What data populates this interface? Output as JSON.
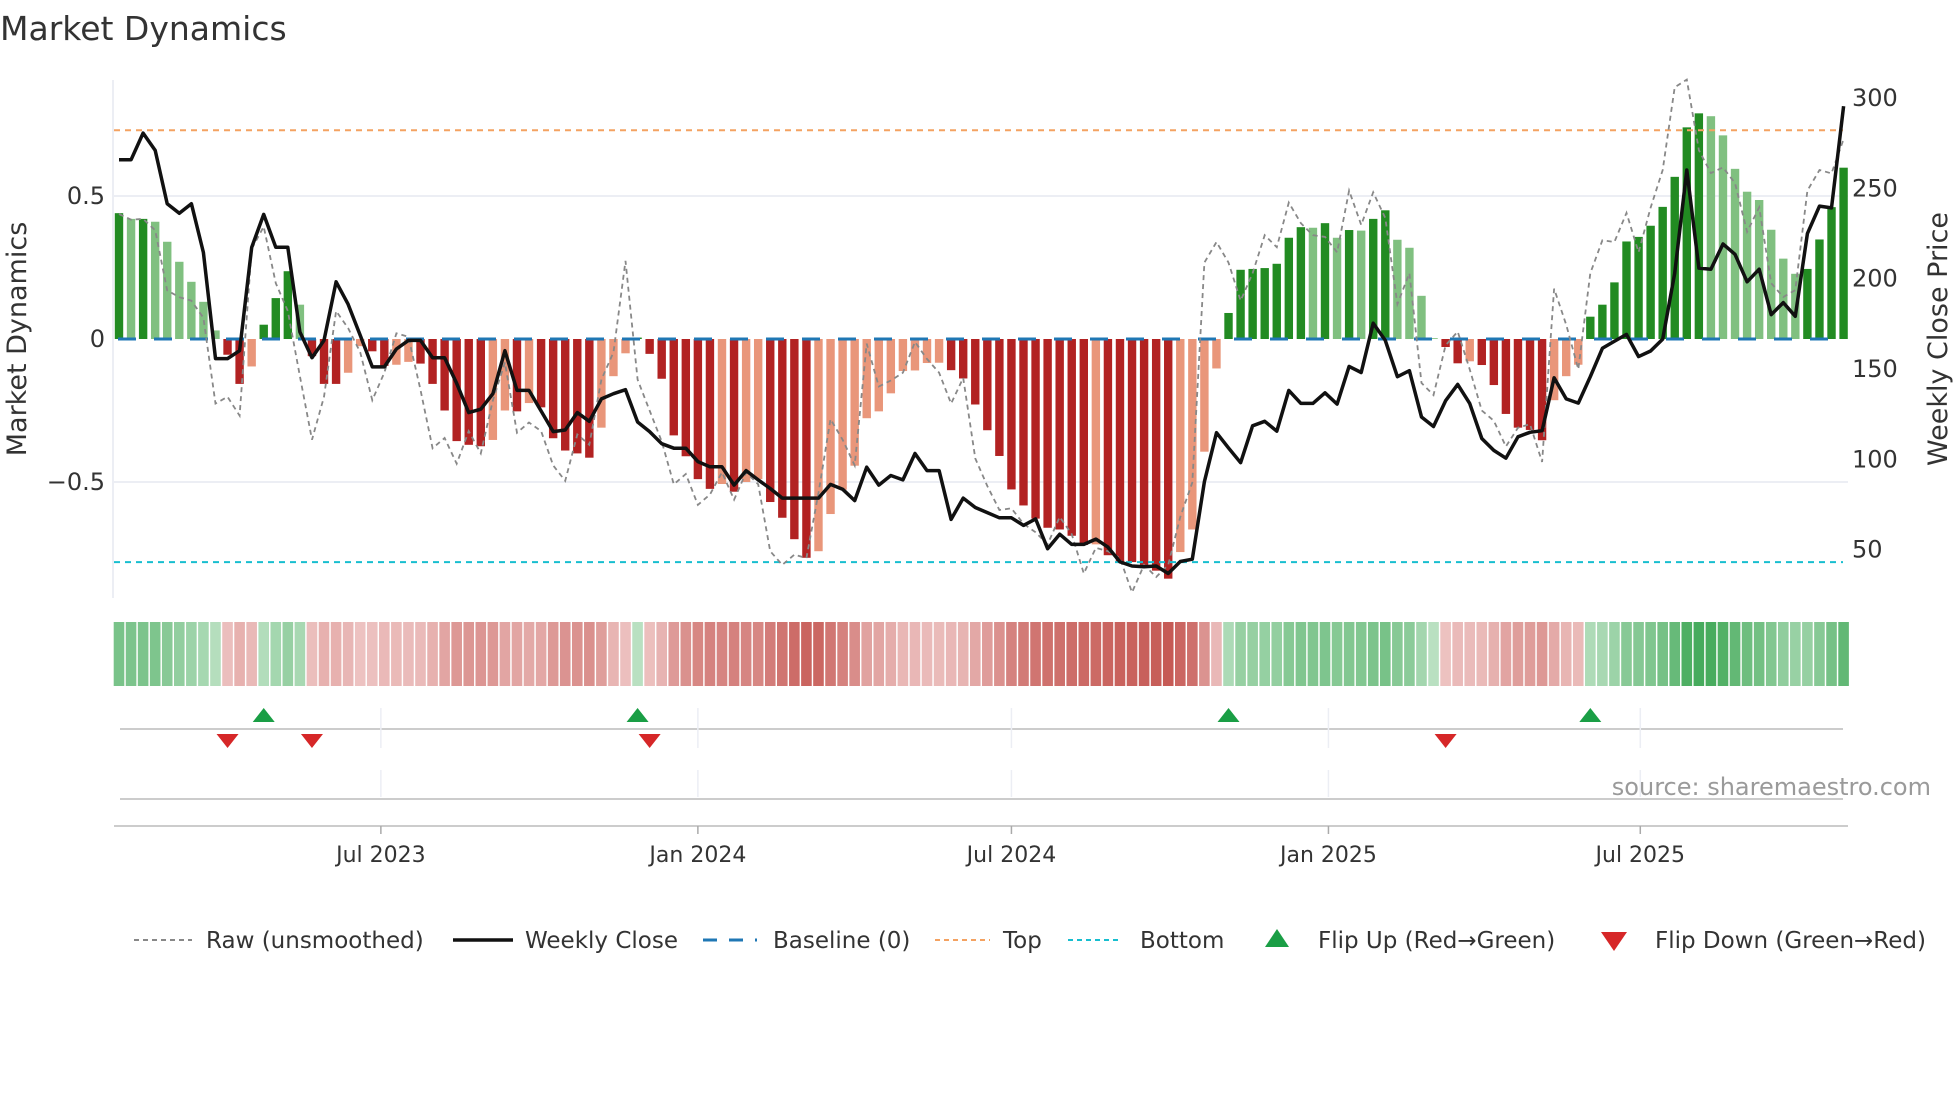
{
  "chart_data": {
    "type": "bar",
    "title": "Market Dynamics",
    "ylabel": "Market Dynamics",
    "y2label": "Weekly Close Price",
    "ylim": [
      -0.9,
      0.9
    ],
    "y2lim": [
      23.6,
      308.5
    ],
    "yticks": [
      {
        "value": 0.5,
        "label": "0.5"
      },
      {
        "value": 0,
        "label": "0"
      },
      {
        "value": -0.5,
        "label": "−0.5"
      }
    ],
    "y2ticks": [
      {
        "value": 300,
        "label": "300"
      },
      {
        "value": 250,
        "label": "250"
      },
      {
        "value": 200,
        "label": "200"
      },
      {
        "value": 150,
        "label": "150"
      },
      {
        "value": 100,
        "label": "100"
      },
      {
        "value": 50,
        "label": "50"
      }
    ],
    "xticks": [
      {
        "date": "2023-07-01",
        "label": "Jul 2023"
      },
      {
        "date": "2024-01-01",
        "label": "Jan 2024"
      },
      {
        "date": "2024-07-01",
        "label": "Jul 2024"
      },
      {
        "date": "2025-01-01",
        "label": "Jan 2025"
      },
      {
        "date": "2025-07-01",
        "label": "Jul 2025"
      }
    ],
    "grid": true,
    "legend_placement": "bottom",
    "top_threshold": 0.73,
    "bottom_threshold": -0.78,
    "baseline": 0,
    "dates": [
      "2023-01-30",
      "2023-02-06",
      "2023-02-13",
      "2023-02-20",
      "2023-02-27",
      "2023-03-06",
      "2023-03-13",
      "2023-03-20",
      "2023-03-27",
      "2023-04-03",
      "2023-04-10",
      "2023-04-17",
      "2023-04-24",
      "2023-05-01",
      "2023-05-08",
      "2023-05-15",
      "2023-05-22",
      "2023-05-29",
      "2023-06-05",
      "2023-06-12",
      "2023-06-19",
      "2023-06-26",
      "2023-07-03",
      "2023-07-10",
      "2023-07-17",
      "2023-07-24",
      "2023-07-31",
      "2023-08-07",
      "2023-08-14",
      "2023-08-21",
      "2023-08-28",
      "2023-09-04",
      "2023-09-11",
      "2023-09-18",
      "2023-09-25",
      "2023-10-02",
      "2023-10-09",
      "2023-10-16",
      "2023-10-23",
      "2023-10-30",
      "2023-11-06",
      "2023-11-13",
      "2023-11-20",
      "2023-11-27",
      "2023-12-04",
      "2023-12-11",
      "2023-12-18",
      "2023-12-25",
      "2024-01-01",
      "2024-01-08",
      "2024-01-15",
      "2024-01-22",
      "2024-01-29",
      "2024-02-05",
      "2024-02-12",
      "2024-02-19",
      "2024-02-26",
      "2024-03-04",
      "2024-03-11",
      "2024-03-18",
      "2024-03-25",
      "2024-04-01",
      "2024-04-08",
      "2024-04-15",
      "2024-04-22",
      "2024-04-29",
      "2024-05-06",
      "2024-05-13",
      "2024-05-20",
      "2024-05-27",
      "2024-06-03",
      "2024-06-10",
      "2024-06-17",
      "2024-06-24",
      "2024-07-01",
      "2024-07-08",
      "2024-07-15",
      "2024-07-22",
      "2024-07-29",
      "2024-08-05",
      "2024-08-12",
      "2024-08-19",
      "2024-08-26",
      "2024-09-02",
      "2024-09-09",
      "2024-09-16",
      "2024-09-23",
      "2024-09-30",
      "2024-10-07",
      "2024-10-14",
      "2024-10-21",
      "2024-10-28",
      "2024-11-04",
      "2024-11-11",
      "2024-11-18",
      "2024-11-25",
      "2024-12-02",
      "2024-12-09",
      "2024-12-16",
      "2024-12-23",
      "2024-12-30",
      "2025-01-06",
      "2025-01-13",
      "2025-01-20",
      "2025-01-27",
      "2025-02-03",
      "2025-02-10",
      "2025-02-17",
      "2025-02-24",
      "2025-03-03",
      "2025-03-10",
      "2025-03-17",
      "2025-03-24",
      "2025-03-31",
      "2025-04-07",
      "2025-04-14",
      "2025-04-21",
      "2025-04-28",
      "2025-05-05",
      "2025-05-12",
      "2025-05-19",
      "2025-05-26",
      "2025-06-02",
      "2025-06-09",
      "2025-06-16",
      "2025-06-23",
      "2025-06-30",
      "2025-07-07",
      "2025-07-14",
      "2025-07-21",
      "2025-07-28",
      "2025-08-04",
      "2025-08-11",
      "2025-08-18",
      "2025-08-25",
      "2025-09-01",
      "2025-09-08",
      "2025-09-15",
      "2025-09-22",
      "2025-09-29",
      "2025-10-06",
      "2025-10-13",
      "2025-10-20",
      "2025-10-27"
    ],
    "series": [
      {
        "name": "Market Dynamics",
        "axis": "left",
        "kind": "bar",
        "values": [
          0.44,
          0.42,
          0.42,
          0.41,
          0.34,
          0.27,
          0.2,
          0.13,
          0.03,
          -0.055,
          -0.157,
          -0.096,
          0.05,
          0.143,
          0.237,
          0.12,
          -0.06,
          -0.157,
          -0.157,
          -0.118,
          -0.025,
          -0.043,
          -0.094,
          -0.09,
          -0.08,
          -0.086,
          -0.157,
          -0.25,
          -0.357,
          -0.37,
          -0.375,
          -0.353,
          -0.25,
          -0.253,
          -0.224,
          -0.239,
          -0.347,
          -0.39,
          -0.4,
          -0.415,
          -0.31,
          -0.13,
          -0.05,
          0.005,
          -0.052,
          -0.139,
          -0.337,
          -0.41,
          -0.49,
          -0.524,
          -0.507,
          -0.534,
          -0.5,
          -0.49,
          -0.57,
          -0.625,
          -0.7,
          -0.765,
          -0.742,
          -0.612,
          -0.527,
          -0.443,
          -0.277,
          -0.253,
          -0.19,
          -0.112,
          -0.11,
          -0.084,
          -0.083,
          -0.109,
          -0.138,
          -0.229,
          -0.319,
          -0.409,
          -0.526,
          -0.582,
          -0.628,
          -0.66,
          -0.666,
          -0.688,
          -0.72,
          -0.718,
          -0.756,
          -0.778,
          -0.78,
          -0.79,
          -0.81,
          -0.838,
          -0.745,
          -0.666,
          -0.394,
          -0.103,
          0.091,
          0.242,
          0.245,
          0.248,
          0.263,
          0.354,
          0.391,
          0.389,
          0.405,
          0.354,
          0.381,
          0.379,
          0.42,
          0.45,
          0.347,
          0.319,
          0.151,
          0.003,
          -0.028,
          -0.085,
          -0.078,
          -0.091,
          -0.161,
          -0.262,
          -0.31,
          -0.318,
          -0.354,
          -0.214,
          -0.13,
          -0.09,
          0.078,
          0.12,
          0.198,
          0.341,
          0.357,
          0.396,
          0.462,
          0.567,
          0.74,
          0.789,
          0.779,
          0.712,
          0.595,
          0.515,
          0.486,
          0.382,
          0.281,
          0.228,
          0.245,
          0.348,
          0.461,
          0.599
        ]
      },
      {
        "name": "Raw (unsmoothed)",
        "axis": "left",
        "kind": "line",
        "values": [
          0.437,
          0.417,
          0.42,
          0.38,
          0.17,
          0.146,
          0.134,
          0.074,
          -0.226,
          -0.202,
          -0.268,
          0.315,
          0.393,
          0.195,
          0.098,
          -0.13,
          -0.352,
          -0.202,
          0.098,
          0.038,
          -0.046,
          -0.214,
          -0.118,
          0.02,
          0.008,
          -0.178,
          -0.382,
          -0.346,
          -0.436,
          -0.322,
          -0.4,
          -0.214,
          -0.082,
          -0.328,
          -0.292,
          -0.322,
          -0.442,
          -0.496,
          -0.334,
          -0.37,
          -0.142,
          -0.046,
          0.273,
          -0.142,
          -0.25,
          -0.358,
          -0.508,
          -0.472,
          -0.58,
          -0.544,
          -0.466,
          -0.562,
          -0.466,
          -0.508,
          -0.742,
          -0.79,
          -0.754,
          -0.766,
          -0.538,
          -0.28,
          -0.352,
          -0.442,
          -0.016,
          -0.166,
          -0.145,
          -0.118,
          -0.01,
          -0.07,
          -0.118,
          -0.226,
          -0.136,
          -0.418,
          -0.514,
          -0.598,
          -0.592,
          -0.646,
          -0.676,
          -0.718,
          -0.622,
          -0.682,
          -0.82,
          -0.73,
          -0.742,
          -0.766,
          -0.886,
          -0.79,
          -0.832,
          -0.79,
          -0.622,
          -0.502,
          0.267,
          0.339,
          0.267,
          0.134,
          0.23,
          0.363,
          0.321,
          0.477,
          0.405,
          0.363,
          0.357,
          0.303,
          0.519,
          0.399,
          0.513,
          0.423,
          0.122,
          0.23,
          -0.154,
          -0.196,
          -0.022,
          0.026,
          -0.106,
          -0.25,
          -0.286,
          -0.376,
          -0.31,
          -0.298,
          -0.43,
          0.176,
          0.05,
          -0.106,
          0.23,
          0.345,
          0.339,
          0.441,
          0.303,
          0.459,
          0.591,
          0.88,
          0.91,
          0.66,
          0.58,
          0.6,
          0.545,
          0.375,
          0.46,
          0.195,
          0.147,
          0.171,
          0.519,
          0.591,
          0.579,
          0.699
        ]
      },
      {
        "name": "Weekly Close",
        "axis": "right",
        "kind": "line",
        "values": [
          265.3,
          265.3,
          280.0,
          270.4,
          240.9,
          235.6,
          240.9,
          213.9,
          155.2,
          155.2,
          159.6,
          216.8,
          235.0,
          216.8,
          216.8,
          169.9,
          155.7,
          165.3,
          197.7,
          185.3,
          168.1,
          150.6,
          150.6,
          160.5,
          165.3,
          165.3,
          155.7,
          155.7,
          141.5,
          125.3,
          127.2,
          135.8,
          159.6,
          137.6,
          137.6,
          126.2,
          114.8,
          115.7,
          125.3,
          120.5,
          132.9,
          135.8,
          138.0,
          120.1,
          114.8,
          108.1,
          105.6,
          105.6,
          98.2,
          95.3,
          95.3,
          85.2,
          93.2,
          88.1,
          83.3,
          78.0,
          78.0,
          78.0,
          78.0,
          85.6,
          82.9,
          76.6,
          95.1,
          85.2,
          90.5,
          88.1,
          102.7,
          93.2,
          93.2,
          66.2,
          78.0,
          72.8,
          70.0,
          67.1,
          67.1,
          62.9,
          66.5,
          50.0,
          58.0,
          52.4,
          52.4,
          55.3,
          50.9,
          42.7,
          40.4,
          40.0,
          40.4,
          36.3,
          42.9,
          44.2,
          87.1,
          114.2,
          105.8,
          97.6,
          118.0,
          120.5,
          115.1,
          137.6,
          130.4,
          130.4,
          136.3,
          130.0,
          150.9,
          147.5,
          174.8,
          165.3,
          145.2,
          148.5,
          122.9,
          117.6,
          131.9,
          140.9,
          130.4,
          111.0,
          104.4,
          100.1,
          111.9,
          114.4,
          115.3,
          144.6,
          132.9,
          130.6,
          145.2,
          160.9,
          164.8,
          168.6,
          156.3,
          159.4,
          166.0,
          202.4,
          259.6,
          205.3,
          204.7,
          218.6,
          212.9,
          197.7,
          204.7,
          179.5,
          186.2,
          178.6,
          224.4,
          239.6,
          238.6,
          294.9
        ]
      }
    ],
    "flip_up_dates": [
      "2023-04-24",
      "2023-11-27",
      "2024-11-04",
      "2025-06-02"
    ],
    "flip_down_dates": [
      "2023-04-03",
      "2023-05-22",
      "2023-12-04",
      "2025-03-10"
    ],
    "colors": {
      "up_strong": "#228b22",
      "up_weak": "#80c080",
      "down_strong": "#b22222",
      "down_weak": "#e9967a",
      "raw": "#888888",
      "close": "#111111",
      "baseline": "#1f77b4",
      "top": "#f4a261",
      "bottom": "#17becf",
      "flip_up": "#1a9e45",
      "flip_down": "#d62728",
      "strip_green": "#3fa856",
      "strip_red": "#c65a55"
    },
    "legend": [
      {
        "label": "Raw (unsmoothed)",
        "style": "dotted-gray"
      },
      {
        "label": "Weekly Close",
        "style": "solid-black"
      },
      {
        "label": "Baseline (0)",
        "style": "dashed-blue"
      },
      {
        "label": "Top",
        "style": "dotted-orange"
      },
      {
        "label": "Bottom",
        "style": "dotted-cyan"
      },
      {
        "label": "Flip Up (Red→Green)",
        "style": "triangle-up-green"
      },
      {
        "label": "Flip Down (Green→Red)",
        "style": "triangle-down-red"
      }
    ],
    "source": "source: sharemaestro.com"
  }
}
